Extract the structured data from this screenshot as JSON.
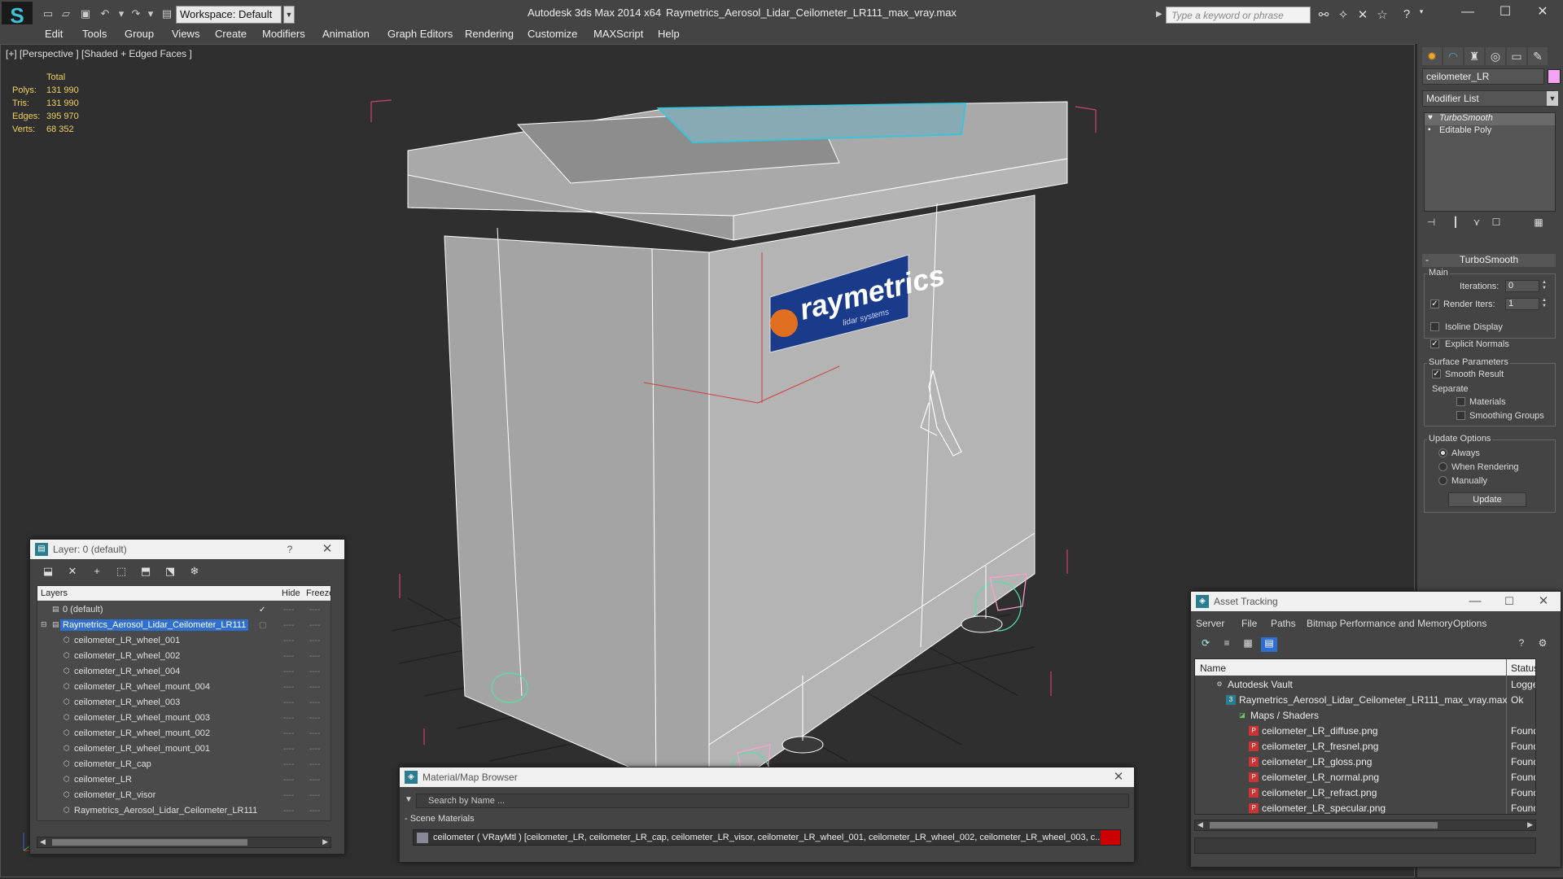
{
  "app": {
    "title": "Autodesk 3ds Max  2014 x64",
    "file": "Raymetrics_Aerosol_Lidar_Ceilometer_LR111_max_vray.max",
    "workspace": "Workspace: Default",
    "search_placeholder": "Type a keyword or phrase",
    "accent": "#3fc1d8"
  },
  "menu": [
    "Edit",
    "Tools",
    "Group",
    "Views",
    "Create",
    "Modifiers",
    "Animation",
    "Graph Editors",
    "Rendering",
    "Customize",
    "MAXScript",
    "Help"
  ],
  "viewport": {
    "label": "[+] [Perspective ] [Shaded + Edged Faces ]",
    "stats": {
      "header": "Total",
      "polys_label": "Polys:",
      "polys": "131 990",
      "tris_label": "Tris:",
      "tris": "131 990",
      "edges_label": "Edges:",
      "edges": "395 970",
      "verts_label": "Verts:",
      "verts": "68 352"
    },
    "logo_text": "raymetrics",
    "logo_sub": "lidar systems"
  },
  "command_panel": {
    "object_name": "ceilometer_LR",
    "object_color": "#f3a4f3",
    "modifier_list": "Modifier List",
    "stack": [
      "TurboSmooth",
      "Editable Poly"
    ],
    "rollout_title": "TurboSmooth",
    "main_group": "Main",
    "iterations_label": "Iterations:",
    "iterations": "0",
    "render_iters_label": "Render Iters:",
    "render_iters": "1",
    "isoline_label": "Isoline Display",
    "explicit_normals_label": "Explicit Normals",
    "surface_group": "Surface Parameters",
    "smooth_result_label": "Smooth Result",
    "separate_label": "Separate",
    "materials_label": "Materials",
    "smoothing_groups_label": "Smoothing Groups",
    "update_group": "Update Options",
    "always_label": "Always",
    "when_rendering_label": "When Rendering",
    "manually_label": "Manually",
    "update_button": "Update"
  },
  "layer_window": {
    "title": "Layer: 0 (default)",
    "help": "?",
    "col_layers": "Layers",
    "col_hide": "Hide",
    "col_freeze": "Freeze",
    "rows": [
      "0 (default)",
      "Raymetrics_Aerosol_Lidar_Ceilometer_LR111",
      "ceilometer_LR_wheel_001",
      "ceilometer_LR_wheel_002",
      "ceilometer_LR_wheel_004",
      "ceilometer_LR_wheel_mount_004",
      "ceilometer_LR_wheel_003",
      "ceilometer_LR_wheel_mount_003",
      "ceilometer_LR_wheel_mount_002",
      "ceilometer_LR_wheel_mount_001",
      "ceilometer_LR_cap",
      "ceilometer_LR",
      "ceilometer_LR_visor",
      "Raymetrics_Aerosol_Lidar_Ceilometer_LR111"
    ],
    "dash": "----"
  },
  "material_browser": {
    "title": "Material/Map Browser",
    "search_placeholder": "Search by Name ...",
    "section": "- Scene Materials",
    "row": "ceilometer  ( VRayMtl )  [ceilometer_LR, ceilometer_LR_cap, ceilometer_LR_visor, ceilometer_LR_wheel_001, ceilometer_LR_wheel_002, ceilometer_LR_wheel_003, c..."
  },
  "asset_tracking": {
    "title": "Asset Tracking",
    "menu": [
      "Server",
      "File",
      "Paths",
      "Bitmap Performance and Memory",
      "Options"
    ],
    "col_name": "Name",
    "col_status": "Status",
    "rows": [
      {
        "name": "Autodesk Vault",
        "status": "Logged O"
      },
      {
        "name": "Raymetrics_Aerosol_Lidar_Ceilometer_LR111_max_vray.max",
        "status": "Ok"
      },
      {
        "name": "Maps / Shaders",
        "status": ""
      },
      {
        "name": "ceilometer_LR_diffuse.png",
        "status": "Found"
      },
      {
        "name": "ceilometer_LR_fresnel.png",
        "status": "Found"
      },
      {
        "name": "ceilometer_LR_gloss.png",
        "status": "Found"
      },
      {
        "name": "ceilometer_LR_normal.png",
        "status": "Found"
      },
      {
        "name": "ceilometer_LR_refract.png",
        "status": "Found"
      },
      {
        "name": "ceilometer_LR_specular.png",
        "status": "Found"
      }
    ]
  }
}
